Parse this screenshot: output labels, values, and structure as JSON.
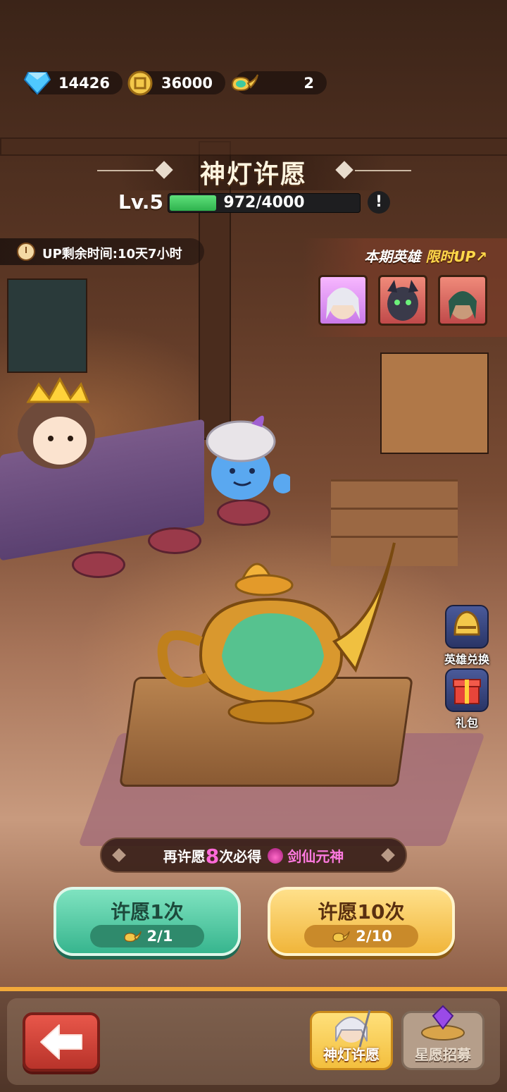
{
  "currencies": [
    {
      "icon": "diamond-icon",
      "value": "14426"
    },
    {
      "icon": "gold-coin-icon",
      "value": "36000"
    },
    {
      "icon": "magic-lamp-icon",
      "value": "2"
    }
  ],
  "title": "神灯许愿",
  "level": {
    "label": "Lv.5",
    "progress": "972/4000",
    "progress_fraction": 0.243
  },
  "info_button": "!",
  "up_timer": "UP剩余时间:10天7小时",
  "featured": {
    "title_a": "本期英雄",
    "title_b": "限时UP"
  },
  "side_buttons": {
    "hero_exchange": "英雄兑换",
    "gift": "礼包"
  },
  "pity": {
    "prefix": "再许愿",
    "count": "8",
    "middle": "次必得",
    "hero": "剑仙元神"
  },
  "wish_1": {
    "label": "许愿1次",
    "cost": "2/1"
  },
  "wish_10": {
    "label": "许愿10次",
    "cost": "2/10"
  },
  "tabs": {
    "lamp": "神灯许愿",
    "star": "星愿招募"
  },
  "colors": {
    "accent_gold": "#f2a93a",
    "xp_green": "#3fc95e",
    "pink": "#ff6ad8"
  }
}
